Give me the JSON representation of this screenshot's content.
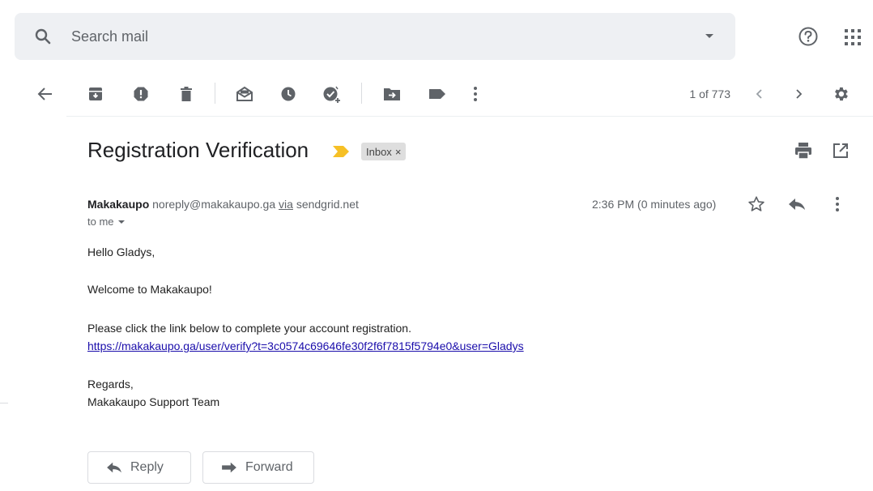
{
  "search": {
    "placeholder": "Search mail",
    "search_icon": "search-icon",
    "options_icon": "caret-down-icon"
  },
  "header_icons": {
    "help": "help-icon",
    "apps": "apps-grid-icon"
  },
  "toolbar": {
    "buttons": [
      {
        "name": "back",
        "icon": "arrow-left-icon"
      },
      {
        "name": "archive",
        "icon": "archive-icon"
      },
      {
        "name": "report-spam",
        "icon": "report-spam-icon"
      },
      {
        "name": "delete",
        "icon": "trash-icon"
      },
      {
        "name": "mark-unread",
        "icon": "mark-unread-icon"
      },
      {
        "name": "snooze",
        "icon": "clock-icon"
      },
      {
        "name": "add-to-tasks",
        "icon": "add-task-icon"
      },
      {
        "name": "move-to",
        "icon": "move-to-folder-icon"
      },
      {
        "name": "labels",
        "icon": "label-icon"
      },
      {
        "name": "more",
        "icon": "more-vert-icon"
      }
    ],
    "pagination": "1 of 773",
    "older_icon": "chevron-left-icon",
    "newer_icon": "chevron-right-icon",
    "settings_icon": "gear-icon"
  },
  "email": {
    "subject": "Registration Verification",
    "importance_color": "#f6c026",
    "label": "Inbox",
    "label_remove": "×",
    "sender_name": "Makakaupo",
    "sender_email": "noreply@makakaupo.ga",
    "via": "via",
    "via_domain": "sendgrid.net",
    "to": "to me",
    "timestamp": "2:36 PM (0 minutes ago)",
    "body": {
      "greeting": "Hello Gladys,",
      "welcome": "Welcome to Makakaupo!",
      "instruction": "Please click the link below to complete your account registration.",
      "link": "https://makakaupo.ga/user/verify?t=3c0574c69646fe30f2f6f7815f5794e0&user=Gladys",
      "signoff": "Regards,",
      "signature": "Makakaupo Support Team"
    }
  },
  "actions": {
    "reply_label": "Reply",
    "forward_label": "Forward"
  },
  "colors": {
    "search_bg": "#eef0f3",
    "icon_gray": "#5f6368",
    "link_blue": "#1a0dab"
  }
}
